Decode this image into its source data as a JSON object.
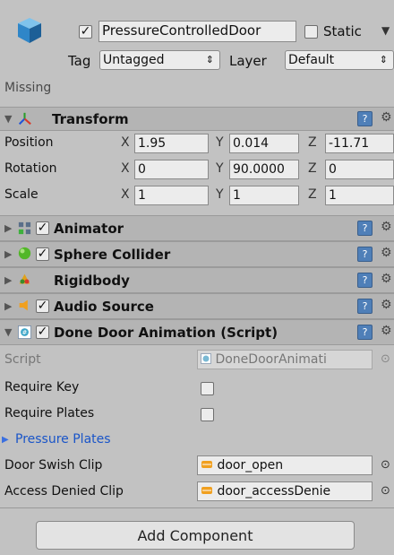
{
  "object": {
    "name": "PressureControlledDoor",
    "static_label": "Static",
    "tag_label": "Tag",
    "tag_value": "Untagged",
    "layer_label": "Layer",
    "layer_value": "Default",
    "missing_label": "Missing"
  },
  "transform": {
    "title": "Transform",
    "position_label": "Position",
    "rotation_label": "Rotation",
    "scale_label": "Scale",
    "x": "X",
    "y": "Y",
    "z": "Z",
    "position": [
      "1.95",
      "0.014",
      "-11.71"
    ],
    "rotation": [
      "0",
      "90.0000",
      "0"
    ],
    "scale": [
      "1",
      "1",
      "1"
    ]
  },
  "components": [
    {
      "title": "Animator",
      "icon": "animator-icon"
    },
    {
      "title": "Sphere Collider",
      "icon": "sphere-collider-icon"
    },
    {
      "title": "Rigidbody",
      "icon": "rigidbody-icon"
    },
    {
      "title": "Audio Source",
      "icon": "audio-source-icon"
    }
  ],
  "script_component": {
    "title": "Done Door Animation (Script)",
    "script_label": "Script",
    "script_value": "DoneDoorAnimati",
    "require_key_label": "Require Key",
    "require_plates_label": "Require Plates",
    "pressure_plates_label": "Pressure Plates",
    "door_swish_label": "Door Swish Clip",
    "door_swish_value": "door_open",
    "access_denied_label": "Access Denied Clip",
    "access_denied_value": "door_accessDenie"
  },
  "add_component_label": "Add Component",
  "colors": {
    "background": "#c2c2c2",
    "header": "#b4b4b4",
    "field": "#ececec",
    "link_blue": "#1a55c8"
  }
}
